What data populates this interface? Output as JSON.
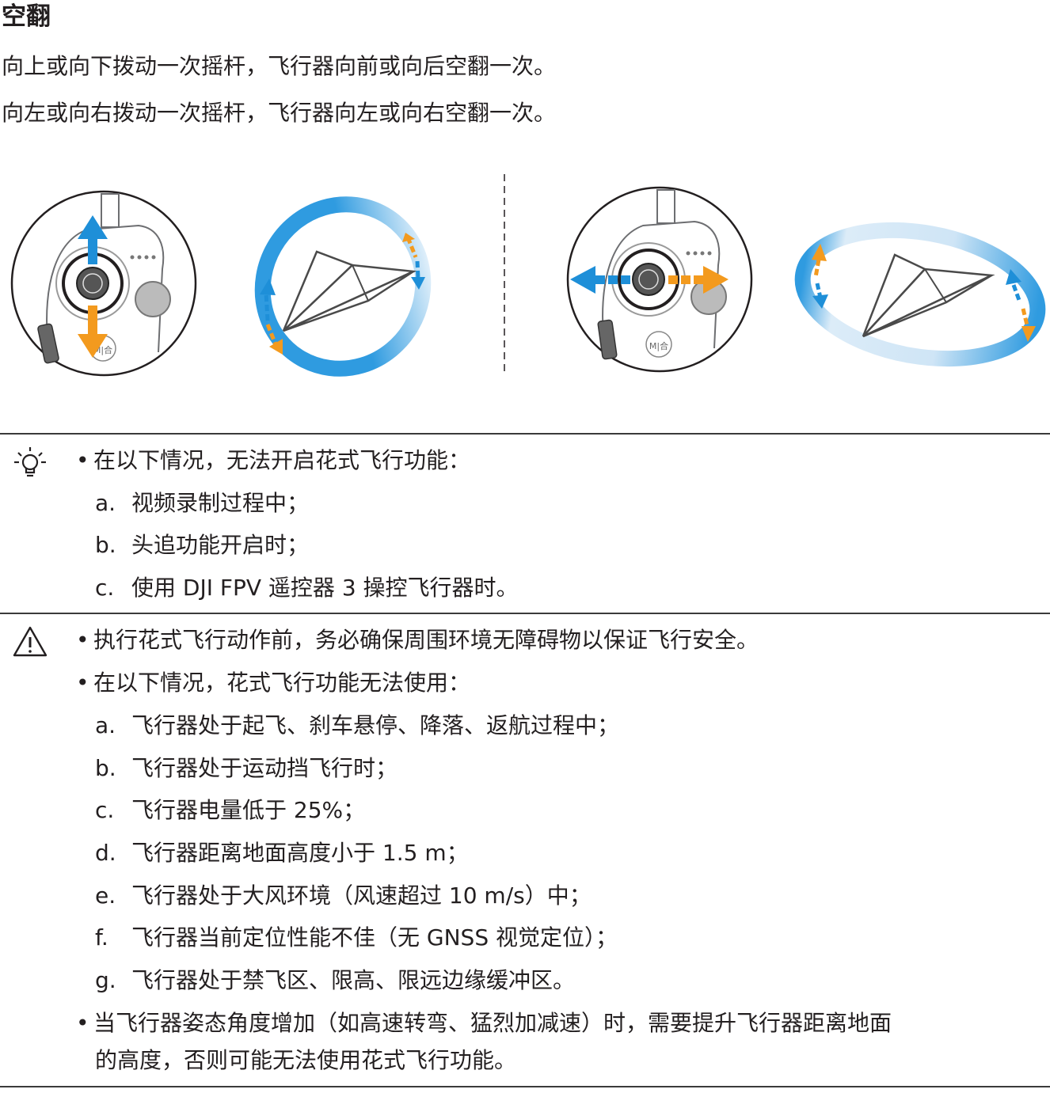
{
  "title": "空翻",
  "intro": [
    "向上或向下拨动一次摇杆，飞行器向前或向后空翻一次。",
    "向左或向右拨动一次摇杆，飞行器向左或向右空翻一次。"
  ],
  "illustrations": {
    "icon_names": [
      "remote-stick-vertical-icon",
      "front-flip-plane-icon",
      "remote-stick-horizontal-icon",
      "side-flip-plane-icon"
    ],
    "colors": {
      "blue": "#1e8fd8",
      "orange": "#f39a1e",
      "ring": "#2f9be0"
    },
    "remote_label": "M|合"
  },
  "tip": {
    "icon": "lightbulb-icon",
    "bullet": "在以下情况，无法开启花式飞行功能：",
    "items": [
      {
        "letter": "a.",
        "text": "视频录制过程中；"
      },
      {
        "letter": "b.",
        "text": "头追功能开启时；"
      },
      {
        "letter": "c.",
        "text": "使用 DJI FPV 遥控器 3 操控飞行器时。"
      }
    ]
  },
  "warning": {
    "icon": "warning-triangle-icon",
    "bullet1": "执行花式飞行动作前，务必确保周围环境无障碍物以保证飞行安全。",
    "bullet2": "在以下情况，花式飞行功能无法使用：",
    "items": [
      {
        "letter": "a.",
        "text": "飞行器处于起飞、刹车悬停、降落、返航过程中；"
      },
      {
        "letter": "b.",
        "text": "飞行器处于运动挡飞行时；"
      },
      {
        "letter": "c.",
        "text": "飞行器电量低于 25%；"
      },
      {
        "letter": "d.",
        "text": "飞行器距离地面高度小于 1.5 m；"
      },
      {
        "letter": "e.",
        "text": "飞行器处于大风环境（风速超过 10 m/s）中；"
      },
      {
        "letter": "f.",
        "text": "飞行器当前定位性能不佳（无 GNSS 视觉定位）；"
      },
      {
        "letter": "g.",
        "text": "飞行器处于禁飞区、限高、限远边缘缓冲区。"
      }
    ],
    "bullet3_line1": "当飞行器姿态角度增加（如高速转弯、猛烈加减速）时，需要提升飞行器距离地面",
    "bullet3_line2": "的高度，否则可能无法使用花式飞行功能。"
  }
}
